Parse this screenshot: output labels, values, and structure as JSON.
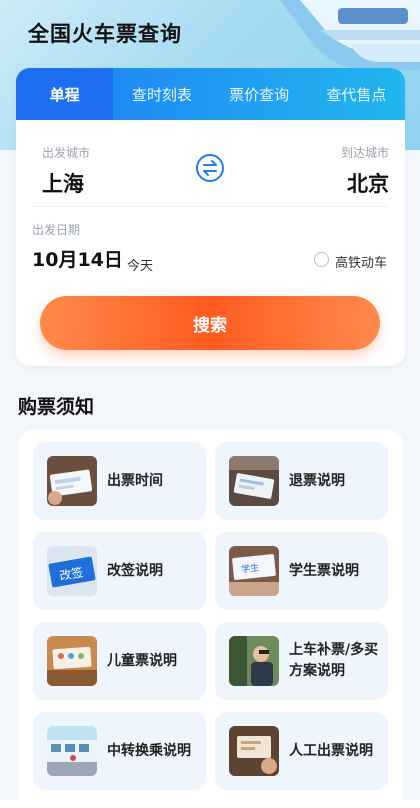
{
  "app": {
    "title": "全国火车票查询"
  },
  "tabs": [
    {
      "label": "单程"
    },
    {
      "label": "查时刻表"
    },
    {
      "label": "票价查询"
    },
    {
      "label": "查代售点"
    }
  ],
  "route": {
    "from_label": "出发城市",
    "from_city": "上海",
    "to_label": "到达城市",
    "to_city": "北京"
  },
  "date": {
    "label": "出发日期",
    "value": "10月14日",
    "relative": "今天"
  },
  "high_speed_filter": {
    "label": "高铁动车",
    "checked": false
  },
  "search": {
    "label": "搜索"
  },
  "notice": {
    "title": "购票须知",
    "items": [
      {
        "label": "出票时间"
      },
      {
        "label": "退票说明"
      },
      {
        "label": "改签说明"
      },
      {
        "label": "学生票说明"
      },
      {
        "label": "儿童票说明"
      },
      {
        "label": "上车补票/多买方案说明"
      },
      {
        "label": "中转换乘说明"
      },
      {
        "label": "人工出票说明"
      }
    ],
    "thumb_text_change": "改签",
    "thumb_text_student": "学生"
  },
  "colors": {
    "accent_blue": "#1f7df5",
    "search_orange": "#ff5b1f"
  }
}
